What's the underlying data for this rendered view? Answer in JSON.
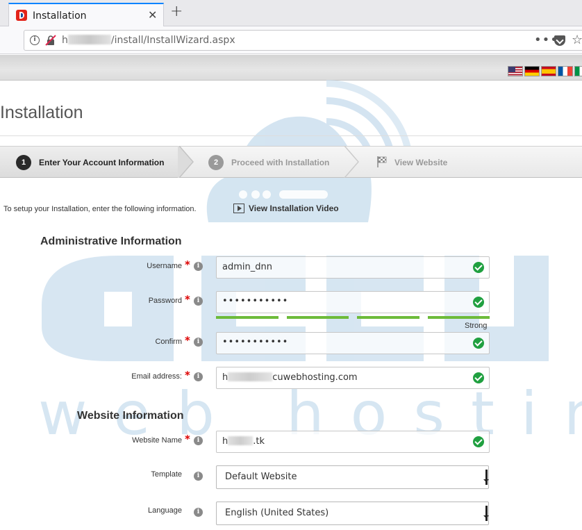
{
  "browser": {
    "tab_title": "Installation",
    "tab_close": "✕",
    "new_tab": "+",
    "url_prefix": "h",
    "url_suffix": "/install/InstallWizard.aspx",
    "more": "•••",
    "star": "☆",
    "icons": [
      "info-icon",
      "insecure-lock-icon",
      "more-icon",
      "pocket-icon",
      "bookmark-star-icon",
      "close-icon",
      "plus-icon"
    ]
  },
  "languages": [
    "en-US",
    "de-DE",
    "es-ES",
    "fr-FR",
    "it-IT"
  ],
  "page": {
    "title": "Installation"
  },
  "steps": [
    {
      "number": "1",
      "label": "Enter Your Account Information",
      "state": "active"
    },
    {
      "number": "2",
      "label": "Proceed with Installation",
      "state": "inactive"
    },
    {
      "label": "View Website",
      "icon": "checkered-flag-icon",
      "state": "inactive"
    }
  ],
  "intro": {
    "text": "To setup your Installation, enter the following information.",
    "video_link": "View Installation Video"
  },
  "admin": {
    "section_title": "Administrative Information",
    "username": {
      "label": "Username",
      "value": "admin_dnn"
    },
    "password": {
      "label": "Password",
      "value": "•••••••••••",
      "strength": "Strong",
      "strength_segments": 4
    },
    "confirm": {
      "label": "Confirm",
      "value": "•••••••••••"
    },
    "email": {
      "label": "Email address:",
      "value_prefix": "h",
      "value_suffix": "cuwebhosting.com"
    }
  },
  "website": {
    "section_title": "Website Information",
    "name": {
      "label": "Website Name",
      "value_prefix": "h",
      "value_suffix": ".tk"
    },
    "template": {
      "label": "Template",
      "value": "Default Website"
    },
    "language": {
      "label": "Language",
      "value": "English (United States)"
    }
  },
  "help_glyph": "i",
  "required_glyph": "*",
  "watermark": {
    "brand": "accu",
    "tagline": "web hosting",
    "color": "#cde0ef"
  },
  "colors": {
    "valid": "#20a040",
    "strength": "#6dbb3a",
    "required": "#dd0000",
    "step_active_badge": "#2a2a2a",
    "step_inactive_badge": "#9a9a9a"
  }
}
